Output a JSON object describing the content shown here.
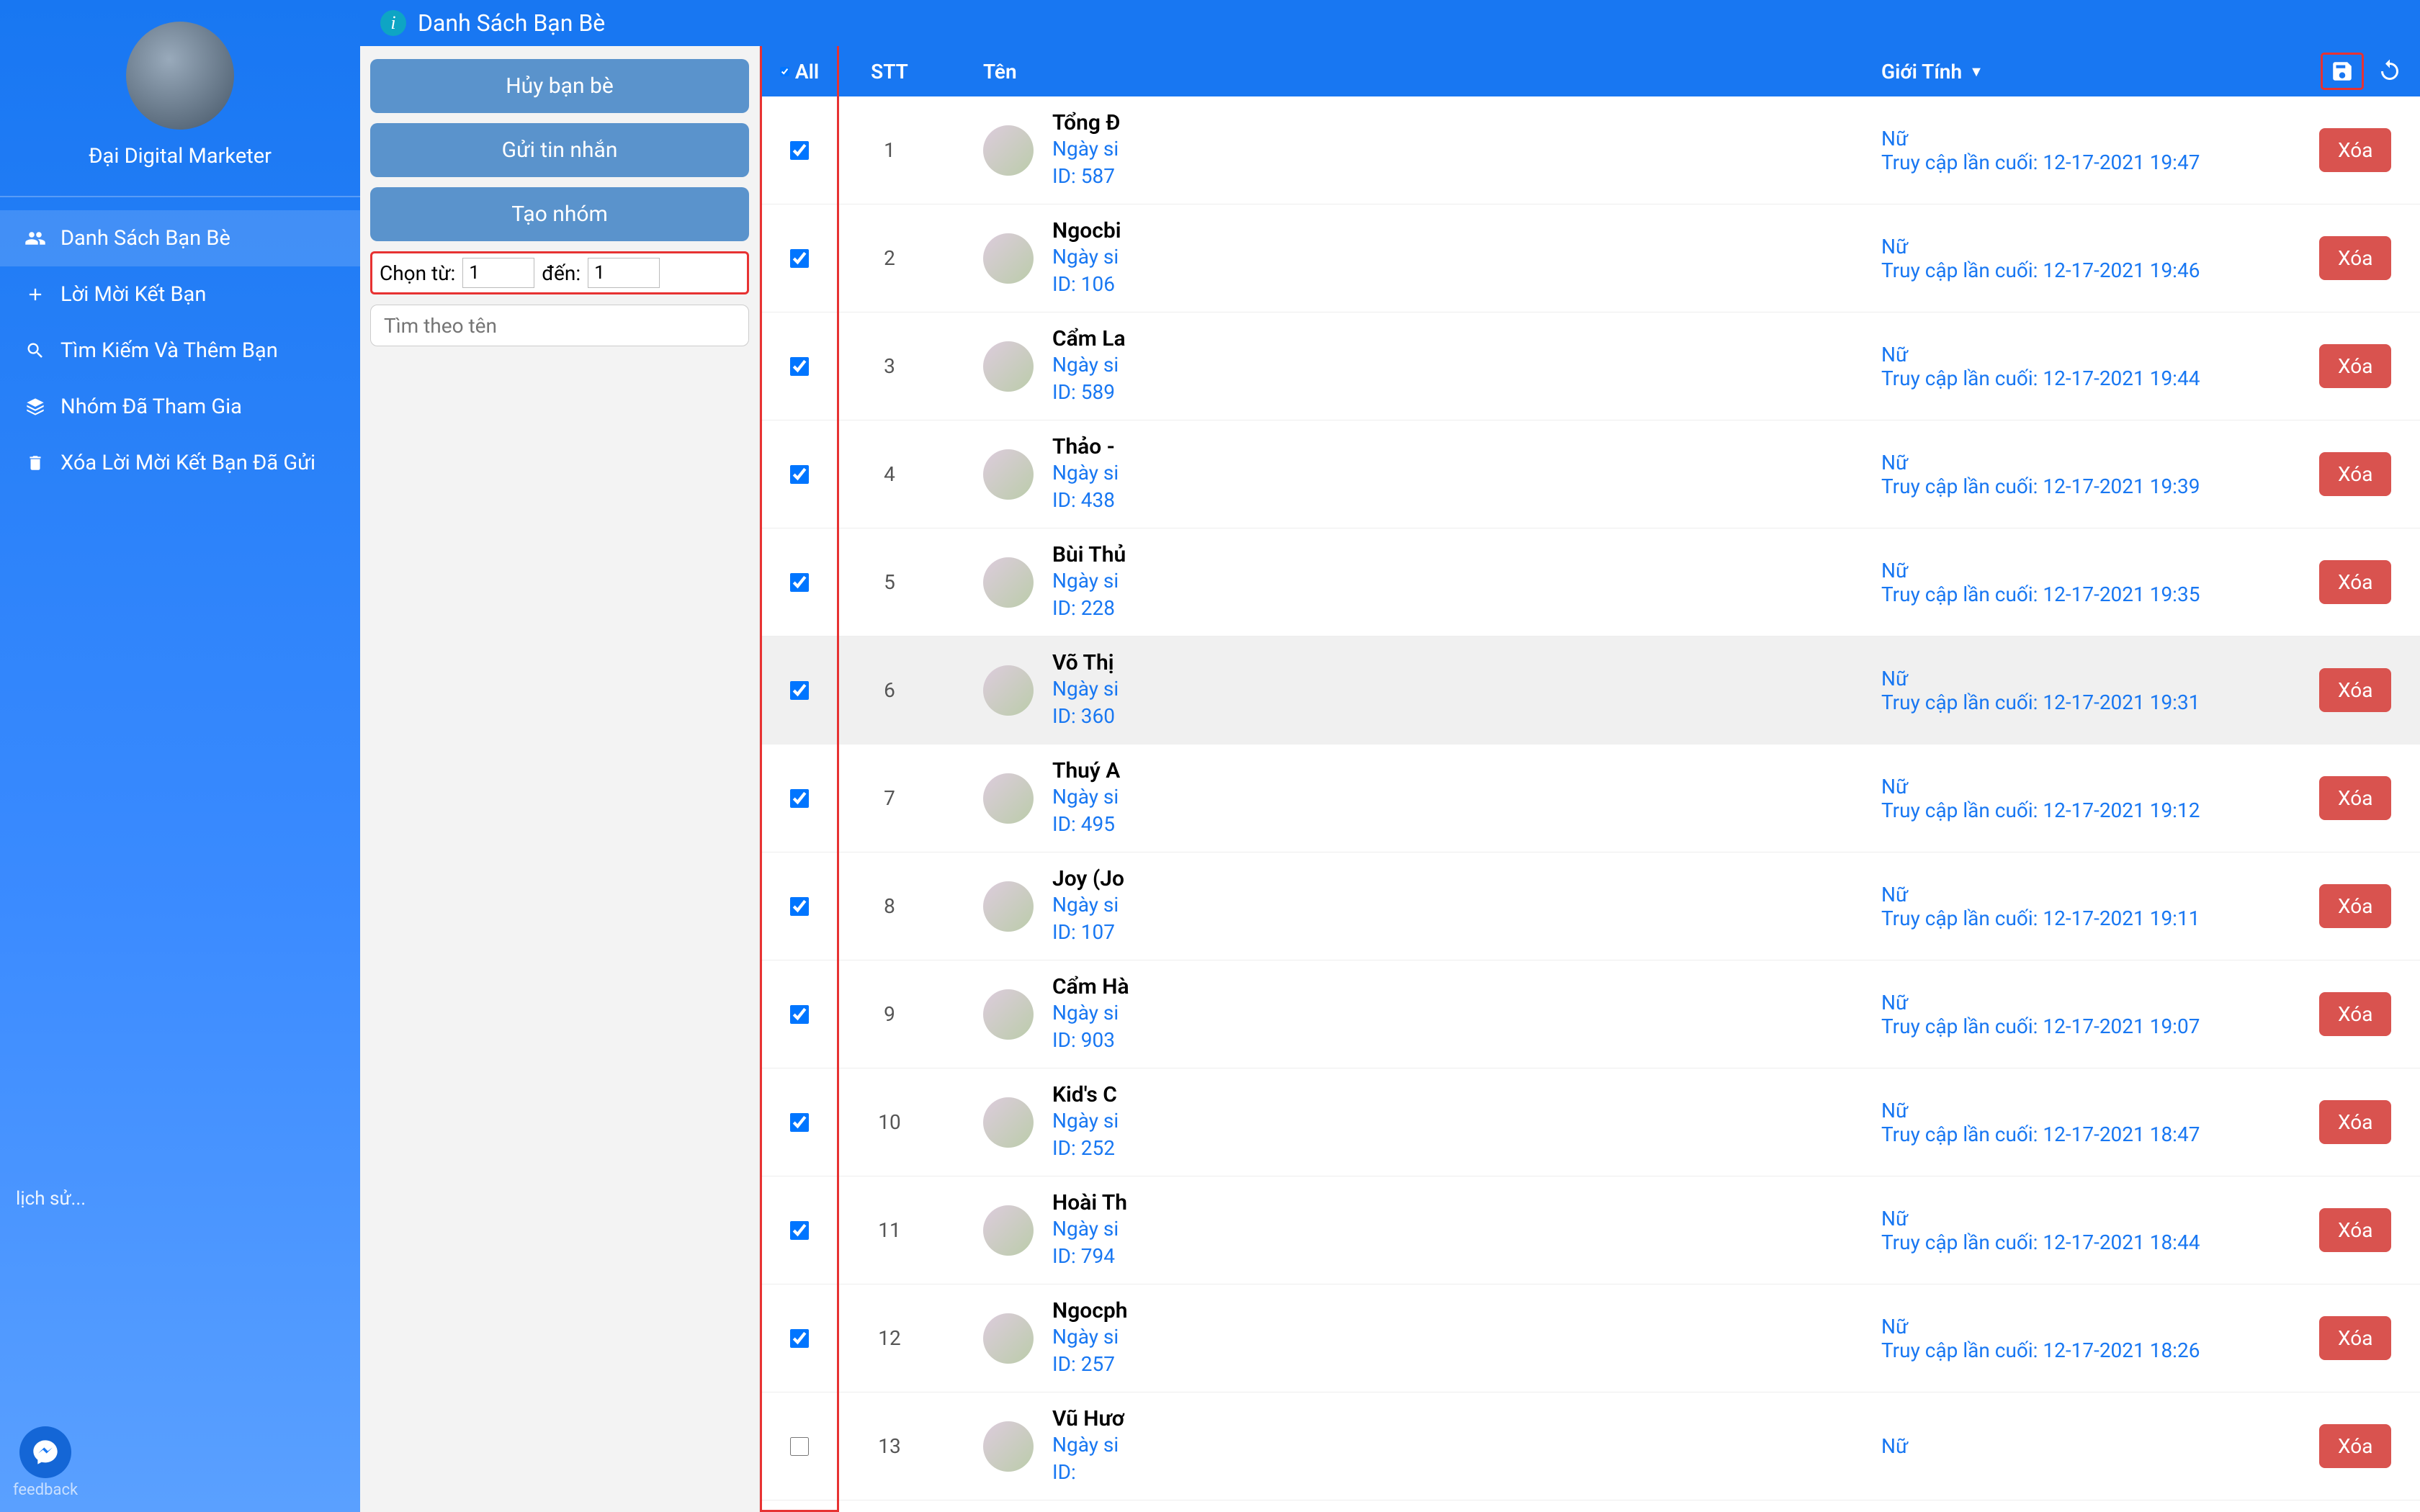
{
  "sidebar": {
    "username": "Đại Digital Marketer",
    "items": [
      {
        "icon": "users",
        "label": "Danh Sách Bạn Bè",
        "active": true
      },
      {
        "icon": "plus",
        "label": "Lời Mời Kết Bạn",
        "active": false
      },
      {
        "icon": "search",
        "label": "Tìm Kiếm Và Thêm Bạn",
        "active": false
      },
      {
        "icon": "layers",
        "label": "Nhóm Đã Tham Gia",
        "active": false
      },
      {
        "icon": "trash",
        "label": "Xóa Lời Mời Kết Bạn Đã Gửi",
        "active": false
      }
    ],
    "history_label": "lịch sử...",
    "feedback_label": "feedback"
  },
  "header": {
    "title": "Danh Sách Bạn Bè"
  },
  "actions": {
    "unfriend": "Hủy bạn bè",
    "send_msg": "Gửi tin nhắn",
    "create_group": "Tạo nhóm",
    "range_from_label": "Chọn từ:",
    "range_from_value": "1",
    "range_to_label": "đến:",
    "range_to_value": "1",
    "search_placeholder": "Tìm theo tên"
  },
  "table": {
    "head": {
      "all": "All",
      "stt": "STT",
      "name": "Tên",
      "gender": "Giới Tính"
    },
    "dob_label": "Ngày si",
    "id_label": "ID:",
    "last_label": "Truy cập lần cuối:",
    "delete_label": "Xóa"
  },
  "rows": [
    {
      "stt": "1",
      "name": "Tổng Đ",
      "id": "587",
      "gender": "Nữ",
      "last": "12-17-2021 19:47",
      "checked": true
    },
    {
      "stt": "2",
      "name": "Ngocbi",
      "id": "106",
      "gender": "Nữ",
      "last": "12-17-2021 19:46",
      "checked": true
    },
    {
      "stt": "3",
      "name": "Cẩm La",
      "id": "589",
      "gender": "Nữ",
      "last": "12-17-2021 19:44",
      "checked": true
    },
    {
      "stt": "4",
      "name": "Thảo -",
      "id": "438",
      "gender": "Nữ",
      "last": "12-17-2021 19:39",
      "checked": true
    },
    {
      "stt": "5",
      "name": "Bùi Thủ",
      "id": "228",
      "gender": "Nữ",
      "last": "12-17-2021 19:35",
      "checked": true
    },
    {
      "stt": "6",
      "name": "Võ Thị",
      "id": "360",
      "gender": "Nữ",
      "last": "12-17-2021 19:31",
      "checked": true,
      "hover": true
    },
    {
      "stt": "7",
      "name": "Thuý A",
      "id": "495",
      "gender": "Nữ",
      "last": "12-17-2021 19:12",
      "checked": true
    },
    {
      "stt": "8",
      "name": "Joy (Jo",
      "id": "107",
      "gender": "Nữ",
      "last": "12-17-2021 19:11",
      "checked": true
    },
    {
      "stt": "9",
      "name": "Cẩm Hà",
      "id": "903",
      "gender": "Nữ",
      "last": "12-17-2021 19:07",
      "checked": true
    },
    {
      "stt": "10",
      "name": "Kid's C",
      "id": "252",
      "gender": "Nữ",
      "last": "12-17-2021 18:47",
      "checked": true
    },
    {
      "stt": "11",
      "name": "Hoài Th",
      "id": "794",
      "gender": "Nữ",
      "last": "12-17-2021 18:44",
      "checked": true
    },
    {
      "stt": "12",
      "name": "Ngocph",
      "id": "257",
      "gender": "Nữ",
      "last": "12-17-2021 18:26",
      "checked": true
    },
    {
      "stt": "13",
      "name": "Vũ Hươ",
      "id": "",
      "gender": "Nữ",
      "last": "",
      "checked": false
    }
  ]
}
